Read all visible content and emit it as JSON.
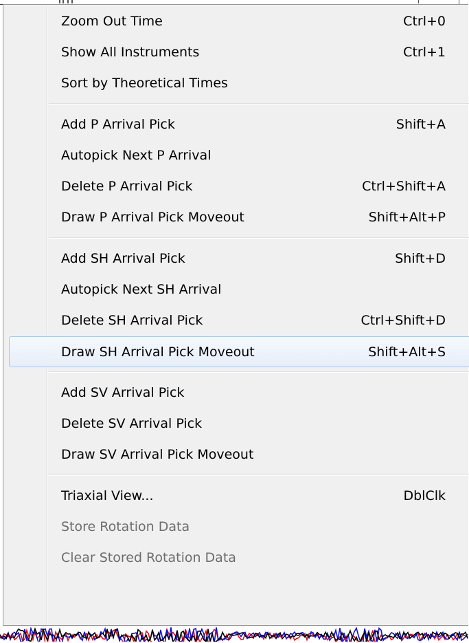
{
  "menu": {
    "groups": [
      {
        "items": [
          {
            "label": "Zoom Out Time",
            "shortcut": "Ctrl+0",
            "enabled": true
          },
          {
            "label": "Show All Instruments",
            "shortcut": "Ctrl+1",
            "enabled": true
          },
          {
            "label": "Sort by Theoretical Times",
            "shortcut": "",
            "enabled": true
          }
        ]
      },
      {
        "items": [
          {
            "label": "Add P Arrival Pick",
            "shortcut": "Shift+A",
            "enabled": true
          },
          {
            "label": "Autopick Next P Arrival",
            "shortcut": "",
            "enabled": true
          },
          {
            "label": "Delete P Arrival Pick",
            "shortcut": "Ctrl+Shift+A",
            "enabled": true
          },
          {
            "label": "Draw P Arrival Pick Moveout",
            "shortcut": "Shift+Alt+P",
            "enabled": true
          }
        ]
      },
      {
        "items": [
          {
            "label": "Add SH Arrival Pick",
            "shortcut": "Shift+D",
            "enabled": true
          },
          {
            "label": "Autopick Next SH Arrival",
            "shortcut": "",
            "enabled": true
          },
          {
            "label": "Delete SH Arrival Pick",
            "shortcut": "Ctrl+Shift+D",
            "enabled": true
          },
          {
            "label": "Draw SH Arrival Pick Moveout",
            "shortcut": "Shift+Alt+S",
            "enabled": true,
            "highlighted": true
          }
        ]
      },
      {
        "items": [
          {
            "label": "Add SV Arrival Pick",
            "shortcut": "",
            "enabled": true
          },
          {
            "label": "Delete SV Arrival Pick",
            "shortcut": "",
            "enabled": true
          },
          {
            "label": "Draw SV Arrival Pick Moveout",
            "shortcut": "",
            "enabled": true
          }
        ]
      },
      {
        "items": [
          {
            "label": "Triaxial View...",
            "shortcut": "DblClk",
            "enabled": true
          },
          {
            "label": "Store Rotation Data",
            "shortcut": "",
            "enabled": false
          },
          {
            "label": "Clear Stored Rotation Data",
            "shortcut": "",
            "enabled": false
          }
        ]
      }
    ]
  },
  "colors": {
    "menu_background": "#f0f0f0",
    "highlight_border": "#a9c7ea",
    "disabled_text": "#6d6d6d",
    "waveform_blue": "#1010e0",
    "waveform_red": "#e01010",
    "waveform_black": "#000000"
  }
}
